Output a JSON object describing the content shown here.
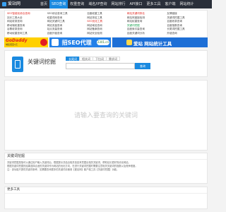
{
  "header": {
    "logo_text": "爱站网",
    "nav": [
      {
        "label": "首页",
        "active": false
      },
      {
        "label": "SEO查询",
        "active": true
      },
      {
        "label": "权重查询",
        "active": false
      },
      {
        "label": "域名/IP查询",
        "active": false
      },
      {
        "label": "网站排行",
        "active": false
      },
      {
        "label": "API接口",
        "active": false
      },
      {
        "label": "更多工具",
        "active": false
      },
      {
        "label": "客户端",
        "active": false
      },
      {
        "label": "网站统计",
        "active": false
      }
    ]
  },
  "links": [
    {
      "text": "SEO智能化综合查询",
      "color": "red"
    },
    {
      "text": "SEO综合查询工具",
      "color": "normal"
    },
    {
      "text": "百度权重工具",
      "color": "normal"
    },
    {
      "text": "网站关键词排名",
      "color": "red"
    },
    {
      "text": "友情链接",
      "color": "normal"
    },
    {
      "text": "站长工具大全",
      "color": "normal"
    },
    {
      "text": "权重词库查询",
      "color": "normal"
    },
    {
      "text": "网站排名工具",
      "color": "normal"
    },
    {
      "text": "网站死链接检测",
      "color": "normal"
    },
    {
      "text": "关键词挖掘工具",
      "color": "normal"
    },
    {
      "text": "网站收录查询",
      "color": "normal"
    },
    {
      "text": "网站关键词工具",
      "color": "normal"
    },
    {
      "text": "SEO优化工具",
      "color": "red"
    },
    {
      "text": "网站权重查询",
      "color": "normal"
    },
    {
      "text": "百度收录查询",
      "color": "normal"
    },
    {
      "text": "移动端权重查询",
      "color": "normal"
    },
    {
      "text": "网站流量查询",
      "color": "normal"
    },
    {
      "text": "网站域名查询",
      "color": "normal"
    },
    {
      "text": "关键词挖掘",
      "color": "green"
    },
    {
      "text": "百度指数查询",
      "color": "normal"
    },
    {
      "text": "谷歌收录查询",
      "color": "normal"
    },
    {
      "text": "站点流量查询",
      "color": "normal"
    },
    {
      "text": "网站备案查询",
      "color": "normal"
    },
    {
      "text": "百度索引量查询",
      "color": "normal"
    },
    {
      "text": "长尾词挖掘工具",
      "color": "normal"
    },
    {
      "text": "移动权重查询工具",
      "color": "normal"
    },
    {
      "text": "百度外链查询",
      "color": "normal"
    },
    {
      "text": "网站安全检测",
      "color": "normal"
    },
    {
      "text": "百度关键词分析",
      "color": "normal"
    },
    {
      "text": "外链查询",
      "color": "normal"
    }
  ],
  "banners": {
    "b1_title": "GoDaddy",
    "b1_sub": "域名低至1元",
    "b2_title": "招SEO代理",
    "b2_logo": "2301.cn",
    "b3_title": "爱站 网站统计工具"
  },
  "search": {
    "title": "关键词挖掘",
    "tabs": [
      {
        "label": "长尾词",
        "active": true
      },
      {
        "label": "相关词",
        "active": false
      },
      {
        "label": "下拉词",
        "active": false
      },
      {
        "label": "需求词",
        "active": false
      }
    ],
    "input_placeholder": "",
    "button_label": "查询"
  },
  "result": {
    "placeholder": "请输入要查询的关键词"
  },
  "info": {
    "title": "关键词挖掘",
    "lines": [
      "关键词挖掘是指可以通过用户输入关键词后，根据提示并结合相关信息来挖掘出相关关键词，帮助站长更好的优化网站。",
      "根据关键词挖掘的结果选择合适的关键词作为网站的优化方向，在进行关键词挖掘时需要注意相关关键词的指数以及竞争程度。",
      "注：该功能只提供关键词参考，如需要查询更多的关键词请使用【爱站网】客户端工具【关键词挖掘】功能。"
    ]
  },
  "more": {
    "title": "更多工具"
  },
  "colors": {
    "accent": "#1a8ae0",
    "topbar": "#2a2f3a",
    "link_red": "#e0261f",
    "link_green": "#17a04f"
  }
}
